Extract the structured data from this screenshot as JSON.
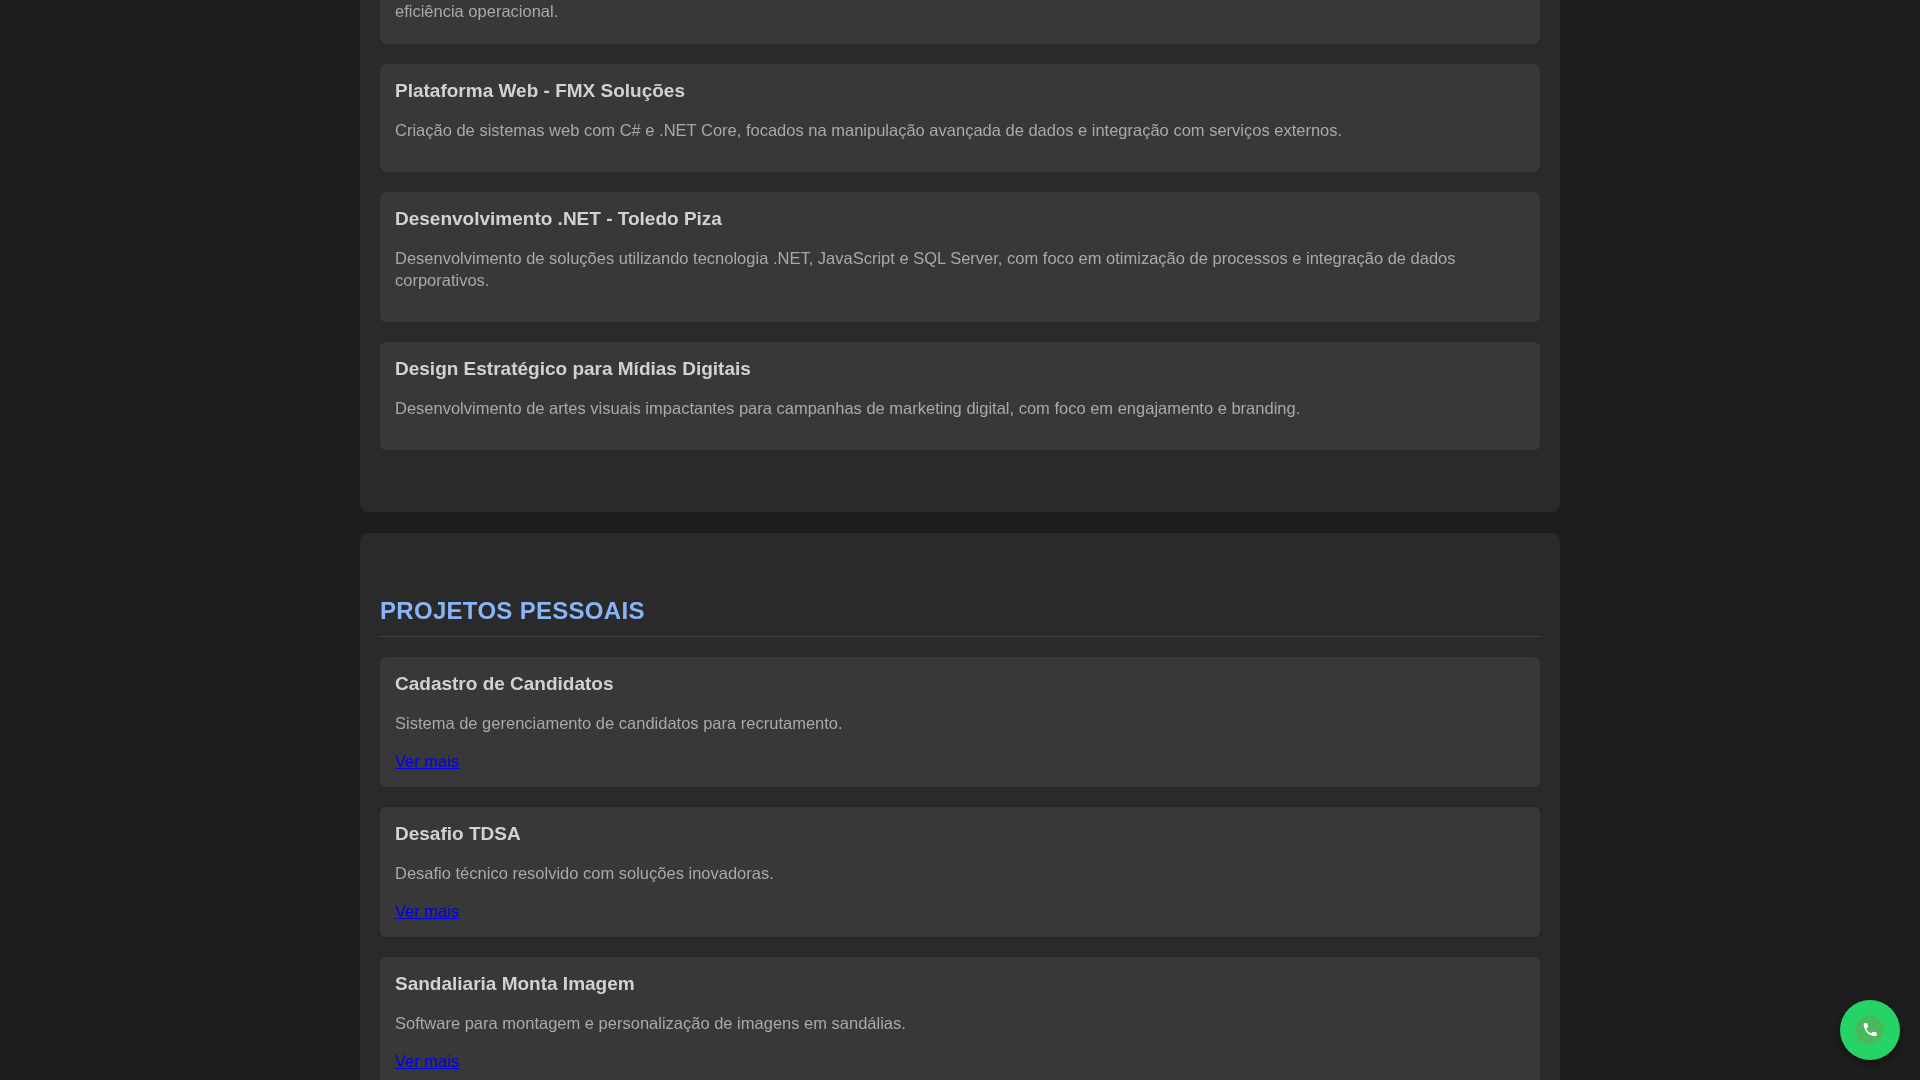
{
  "sections": [
    {
      "cards": [
        {
          "description": "eficiência operacional."
        },
        {
          "title": "Plataforma Web - FMX Soluções",
          "description": "Criação de sistemas web com C# e .NET Core, focados na manipulação avançada de dados e integração com serviços externos."
        },
        {
          "title": "Desenvolvimento .NET - Toledo Piza",
          "description": "Desenvolvimento de soluções utilizando tecnologia .NET, JavaScript e SQL Server, com foco em otimização de processos e integração de dados corporativos."
        },
        {
          "title": "Design Estratégico para Mídias Digitais",
          "description": "Desenvolvimento de artes visuais impactantes para campanhas de marketing digital, com foco em engajamento e branding."
        }
      ]
    },
    {
      "heading": "PROJETOS PESSOAIS",
      "cards": [
        {
          "title": "Cadastro de Candidatos",
          "description": "Sistema de gerenciamento de candidatos para recrutamento.",
          "link": "Ver mais"
        },
        {
          "title": "Desafio TDSA",
          "description": "Desafio técnico resolvido com soluções inovadoras.",
          "link": "Ver mais"
        },
        {
          "title": "Sandaliaria Monta Imagem",
          "description": "Software para montagem e personalização de imagens em sandálias.",
          "link": "Ver mais"
        }
      ]
    }
  ]
}
